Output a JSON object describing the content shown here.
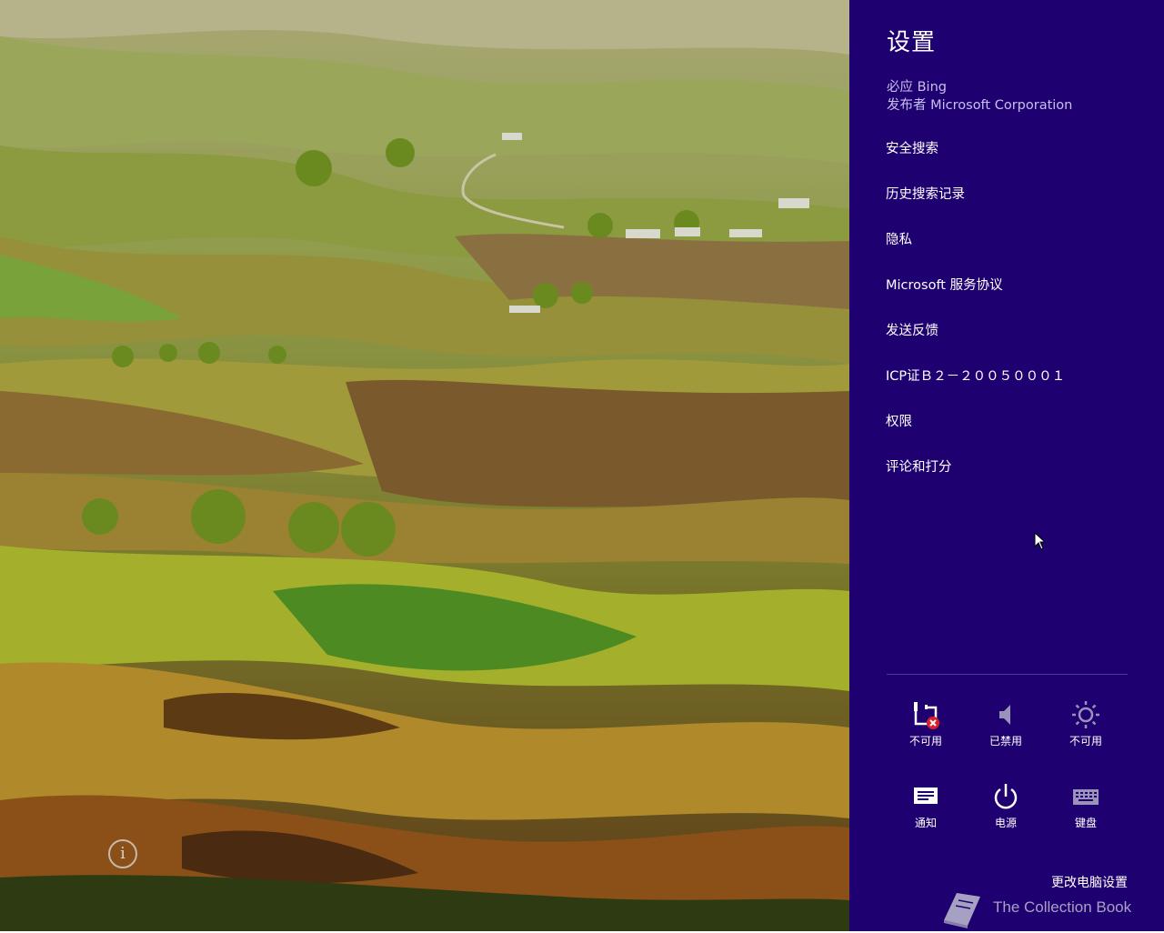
{
  "settings": {
    "title": "设置",
    "app_name": "必应 Bing",
    "publisher": "发布者 Microsoft Corporation",
    "menu": [
      "安全搜索",
      "历史搜索记录",
      "隐私",
      "Microsoft 服务协议",
      "发送反馈",
      "ICP证Ｂ２－２００５０００１",
      "权限",
      "评论和打分"
    ],
    "tiles": [
      {
        "icon": "network-unavailable-icon",
        "label": "不可用"
      },
      {
        "icon": "volume-muted-icon",
        "label": "已禁用"
      },
      {
        "icon": "brightness-icon",
        "label": "不可用"
      },
      {
        "icon": "notifications-icon",
        "label": "通知"
      },
      {
        "icon": "power-icon",
        "label": "电源"
      },
      {
        "icon": "keyboard-icon",
        "label": "键盘"
      }
    ],
    "change_pc_settings": "更改电脑设置"
  },
  "background": {
    "info_button": "i"
  },
  "watermark": {
    "text": "The Collection Book"
  },
  "colors": {
    "charm_bg": "#1f0070",
    "secondary_text": "#c7bff0"
  }
}
